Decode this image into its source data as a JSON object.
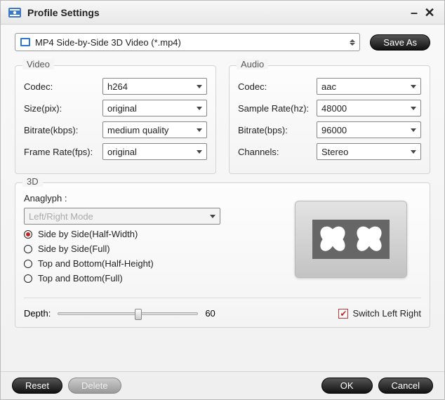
{
  "window": {
    "title": "Profile Settings"
  },
  "profile": {
    "selected": "MP4 Side-by-Side 3D Video (*.mp4)",
    "save_as": "Save As"
  },
  "video": {
    "title": "Video",
    "codec_label": "Codec:",
    "codec_value": "h264",
    "size_label": "Size(pix):",
    "size_value": "original",
    "bitrate_label": "Bitrate(kbps):",
    "bitrate_value": "medium quality",
    "framerate_label": "Frame Rate(fps):",
    "framerate_value": "original"
  },
  "audio": {
    "title": "Audio",
    "codec_label": "Codec:",
    "codec_value": "aac",
    "samplerate_label": "Sample Rate(hz):",
    "samplerate_value": "48000",
    "bitrate_label": "Bitrate(bps):",
    "bitrate_value": "96000",
    "channels_label": "Channels:",
    "channels_value": "Stereo"
  },
  "three_d": {
    "title": "3D",
    "anaglyph_label": "Anaglyph :",
    "anaglyph_value": "Left/Right Mode",
    "modes": {
      "0": "Side by Side(Half-Width)",
      "1": "Side by Side(Full)",
      "2": "Top and Bottom(Half-Height)",
      "3": "Top and Bottom(Full)"
    },
    "selected_mode_index": 0,
    "depth_label": "Depth:",
    "depth_value": "60",
    "switch_label": "Switch Left Right",
    "switch_checked": true
  },
  "buttons": {
    "reset": "Reset",
    "delete": "Delete",
    "ok": "OK",
    "cancel": "Cancel"
  }
}
